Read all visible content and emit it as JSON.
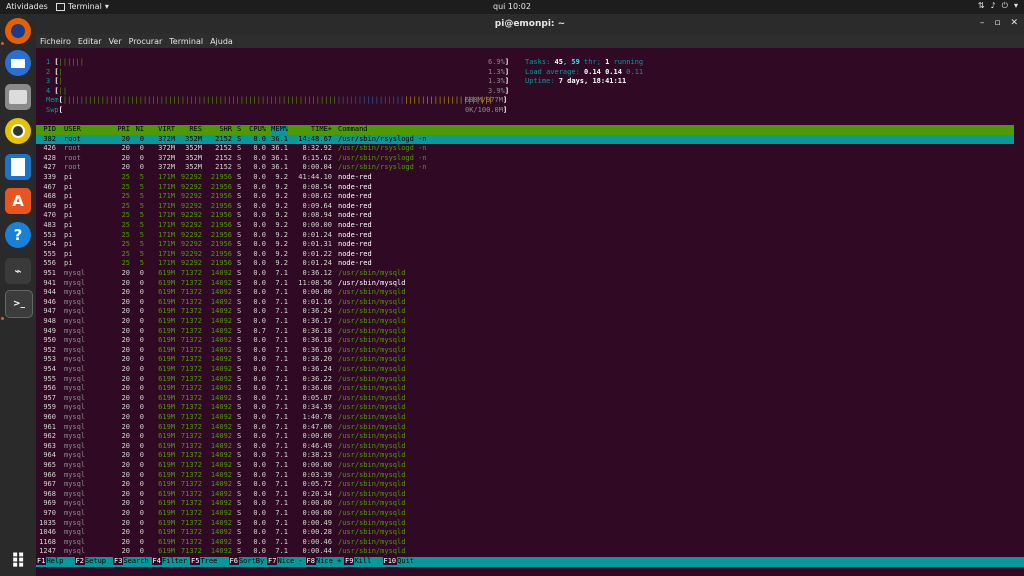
{
  "topbar": {
    "activities": "Atividades",
    "app_name": "Terminal",
    "clock": "qui 10:02"
  },
  "window": {
    "title": "pi@emonpi: ~"
  },
  "menu": [
    "Ficheiro",
    "Editar",
    "Ver",
    "Procurar",
    "Terminal",
    "Ajuda"
  ],
  "meters": {
    "cpus": [
      {
        "label": "1",
        "bars": "||||||",
        "percent": "6.9%"
      },
      {
        "label": "2",
        "bars": "|",
        "percent": "1.3%"
      },
      {
        "label": "3",
        "bars": "|",
        "percent": "1.3%"
      },
      {
        "label": "4",
        "bars": "||",
        "percent": "3.9%"
      }
    ],
    "mem": {
      "label": "Mem",
      "value": "688M/977M"
    },
    "swp": {
      "label": "Swp",
      "value": "0K/100.0M"
    },
    "tasks": {
      "label": "Tasks:",
      "count": "45",
      "threads": "59",
      "thr_label": "thr;",
      "running": "1",
      "running_label": "running"
    },
    "load": {
      "label": "Load average:",
      "v1": "0.14",
      "v2": "0.14",
      "v3": "0.11"
    },
    "uptime": {
      "label": "Uptime:",
      "value": "7 days, 18:41:11"
    }
  },
  "columns": [
    "PID",
    "USER",
    "PRI",
    "NI",
    "VIRT",
    "RES",
    "SHR",
    "S",
    "CPU%",
    "MEM%",
    "TIME+",
    "Command"
  ],
  "processes": [
    {
      "pid": "382",
      "user": "root",
      "pri": "20",
      "ni": "0",
      "virt": "372M",
      "res": "352M",
      "shr": "2152",
      "s": "S",
      "cpu": "0.0",
      "mem": "36.1",
      "time": "14:48.67",
      "cmd": "/usr/sbin/rsyslogd -n"
    },
    {
      "pid": "426",
      "user": "root",
      "pri": "20",
      "ni": "0",
      "virt": "372M",
      "res": "352M",
      "shr": "2152",
      "s": "S",
      "cpu": "0.0",
      "mem": "36.1",
      "time": "8:32.92",
      "cmd": "/usr/sbin/rsyslogd -n"
    },
    {
      "pid": "428",
      "user": "root",
      "pri": "20",
      "ni": "0",
      "virt": "372M",
      "res": "352M",
      "shr": "2152",
      "s": "S",
      "cpu": "0.0",
      "mem": "36.1",
      "time": "6:15.62",
      "cmd": "/usr/sbin/rsyslogd -n"
    },
    {
      "pid": "427",
      "user": "root",
      "pri": "20",
      "ni": "0",
      "virt": "372M",
      "res": "352M",
      "shr": "2152",
      "s": "S",
      "cpu": "0.0",
      "mem": "36.1",
      "time": "0:00.04",
      "cmd": "/usr/sbin/rsyslogd -n"
    },
    {
      "pid": "339",
      "user": "pi",
      "pri": "25",
      "ni": "5",
      "virt": "171M",
      "res": "92292",
      "shr": "21956",
      "s": "S",
      "cpu": "0.0",
      "mem": "9.2",
      "time": "41:44.10",
      "cmd": "node-red"
    },
    {
      "pid": "467",
      "user": "pi",
      "pri": "25",
      "ni": "5",
      "virt": "171M",
      "res": "92292",
      "shr": "21956",
      "s": "S",
      "cpu": "0.0",
      "mem": "9.2",
      "time": "0:08.54",
      "cmd": "node-red"
    },
    {
      "pid": "468",
      "user": "pi",
      "pri": "25",
      "ni": "5",
      "virt": "171M",
      "res": "92292",
      "shr": "21956",
      "s": "S",
      "cpu": "0.0",
      "mem": "9.2",
      "time": "0:08.62",
      "cmd": "node-red"
    },
    {
      "pid": "469",
      "user": "pi",
      "pri": "25",
      "ni": "5",
      "virt": "171M",
      "res": "92292",
      "shr": "21956",
      "s": "S",
      "cpu": "0.0",
      "mem": "9.2",
      "time": "0:09.64",
      "cmd": "node-red"
    },
    {
      "pid": "470",
      "user": "pi",
      "pri": "25",
      "ni": "5",
      "virt": "171M",
      "res": "92292",
      "shr": "21956",
      "s": "S",
      "cpu": "0.0",
      "mem": "9.2",
      "time": "0:08.94",
      "cmd": "node-red"
    },
    {
      "pid": "483",
      "user": "pi",
      "pri": "25",
      "ni": "5",
      "virt": "171M",
      "res": "92292",
      "shr": "21956",
      "s": "S",
      "cpu": "0.0",
      "mem": "9.2",
      "time": "0:00.00",
      "cmd": "node-red"
    },
    {
      "pid": "553",
      "user": "pi",
      "pri": "25",
      "ni": "5",
      "virt": "171M",
      "res": "92292",
      "shr": "21956",
      "s": "S",
      "cpu": "0.0",
      "mem": "9.2",
      "time": "0:01.24",
      "cmd": "node-red"
    },
    {
      "pid": "554",
      "user": "pi",
      "pri": "25",
      "ni": "5",
      "virt": "171M",
      "res": "92292",
      "shr": "21956",
      "s": "S",
      "cpu": "0.0",
      "mem": "9.2",
      "time": "0:01.31",
      "cmd": "node-red"
    },
    {
      "pid": "555",
      "user": "pi",
      "pri": "25",
      "ni": "5",
      "virt": "171M",
      "res": "92292",
      "shr": "21956",
      "s": "S",
      "cpu": "0.0",
      "mem": "9.2",
      "time": "0:01.22",
      "cmd": "node-red"
    },
    {
      "pid": "556",
      "user": "pi",
      "pri": "25",
      "ni": "5",
      "virt": "171M",
      "res": "92292",
      "shr": "21956",
      "s": "S",
      "cpu": "0.0",
      "mem": "9.2",
      "time": "0:01.24",
      "cmd": "node-red"
    },
    {
      "pid": "951",
      "user": "mysql",
      "pri": "20",
      "ni": "0",
      "virt": "619M",
      "res": "71372",
      "shr": "14092",
      "s": "S",
      "cpu": "0.0",
      "mem": "7.1",
      "time": "0:36.12",
      "cmd": "/usr/sbin/mysqld"
    },
    {
      "pid": "941",
      "user": "mysql",
      "pri": "20",
      "ni": "0",
      "virt": "619M",
      "res": "71372",
      "shr": "14092",
      "s": "S",
      "cpu": "0.0",
      "mem": "7.1",
      "time": "11:08.56",
      "cmd": "/usr/sbin/mysqld",
      "main": true
    },
    {
      "pid": "944",
      "user": "mysql",
      "pri": "20",
      "ni": "0",
      "virt": "619M",
      "res": "71372",
      "shr": "14092",
      "s": "S",
      "cpu": "0.0",
      "mem": "7.1",
      "time": "0:00.00",
      "cmd": "/usr/sbin/mysqld"
    },
    {
      "pid": "946",
      "user": "mysql",
      "pri": "20",
      "ni": "0",
      "virt": "619M",
      "res": "71372",
      "shr": "14092",
      "s": "S",
      "cpu": "0.0",
      "mem": "7.1",
      "time": "0:01.16",
      "cmd": "/usr/sbin/mysqld"
    },
    {
      "pid": "947",
      "user": "mysql",
      "pri": "20",
      "ni": "0",
      "virt": "619M",
      "res": "71372",
      "shr": "14092",
      "s": "S",
      "cpu": "0.0",
      "mem": "7.1",
      "time": "0:36.24",
      "cmd": "/usr/sbin/mysqld"
    },
    {
      "pid": "948",
      "user": "mysql",
      "pri": "20",
      "ni": "0",
      "virt": "619M",
      "res": "71372",
      "shr": "14092",
      "s": "S",
      "cpu": "0.0",
      "mem": "7.1",
      "time": "0:36.17",
      "cmd": "/usr/sbin/mysqld"
    },
    {
      "pid": "949",
      "user": "mysql",
      "pri": "20",
      "ni": "0",
      "virt": "619M",
      "res": "71372",
      "shr": "14092",
      "s": "S",
      "cpu": "0.7",
      "mem": "7.1",
      "time": "0:36.18",
      "cmd": "/usr/sbin/mysqld"
    },
    {
      "pid": "950",
      "user": "mysql",
      "pri": "20",
      "ni": "0",
      "virt": "619M",
      "res": "71372",
      "shr": "14092",
      "s": "S",
      "cpu": "0.0",
      "mem": "7.1",
      "time": "0:36.18",
      "cmd": "/usr/sbin/mysqld"
    },
    {
      "pid": "952",
      "user": "mysql",
      "pri": "20",
      "ni": "0",
      "virt": "619M",
      "res": "71372",
      "shr": "14092",
      "s": "S",
      "cpu": "0.0",
      "mem": "7.1",
      "time": "0:36.10",
      "cmd": "/usr/sbin/mysqld"
    },
    {
      "pid": "953",
      "user": "mysql",
      "pri": "20",
      "ni": "0",
      "virt": "619M",
      "res": "71372",
      "shr": "14092",
      "s": "S",
      "cpu": "0.0",
      "mem": "7.1",
      "time": "0:36.20",
      "cmd": "/usr/sbin/mysqld"
    },
    {
      "pid": "954",
      "user": "mysql",
      "pri": "20",
      "ni": "0",
      "virt": "619M",
      "res": "71372",
      "shr": "14092",
      "s": "S",
      "cpu": "0.0",
      "mem": "7.1",
      "time": "0:36.24",
      "cmd": "/usr/sbin/mysqld"
    },
    {
      "pid": "955",
      "user": "mysql",
      "pri": "20",
      "ni": "0",
      "virt": "619M",
      "res": "71372",
      "shr": "14092",
      "s": "S",
      "cpu": "0.0",
      "mem": "7.1",
      "time": "0:36.22",
      "cmd": "/usr/sbin/mysqld"
    },
    {
      "pid": "956",
      "user": "mysql",
      "pri": "20",
      "ni": "0",
      "virt": "619M",
      "res": "71372",
      "shr": "14092",
      "s": "S",
      "cpu": "0.0",
      "mem": "7.1",
      "time": "0:36.08",
      "cmd": "/usr/sbin/mysqld"
    },
    {
      "pid": "957",
      "user": "mysql",
      "pri": "20",
      "ni": "0",
      "virt": "619M",
      "res": "71372",
      "shr": "14092",
      "s": "S",
      "cpu": "0.0",
      "mem": "7.1",
      "time": "0:05.87",
      "cmd": "/usr/sbin/mysqld"
    },
    {
      "pid": "959",
      "user": "mysql",
      "pri": "20",
      "ni": "0",
      "virt": "619M",
      "res": "71372",
      "shr": "14092",
      "s": "S",
      "cpu": "0.0",
      "mem": "7.1",
      "time": "0:34.39",
      "cmd": "/usr/sbin/mysqld"
    },
    {
      "pid": "960",
      "user": "mysql",
      "pri": "20",
      "ni": "0",
      "virt": "619M",
      "res": "71372",
      "shr": "14092",
      "s": "S",
      "cpu": "0.0",
      "mem": "7.1",
      "time": "1:40.78",
      "cmd": "/usr/sbin/mysqld"
    },
    {
      "pid": "961",
      "user": "mysql",
      "pri": "20",
      "ni": "0",
      "virt": "619M",
      "res": "71372",
      "shr": "14092",
      "s": "S",
      "cpu": "0.0",
      "mem": "7.1",
      "time": "0:47.00",
      "cmd": "/usr/sbin/mysqld"
    },
    {
      "pid": "962",
      "user": "mysql",
      "pri": "20",
      "ni": "0",
      "virt": "619M",
      "res": "71372",
      "shr": "14092",
      "s": "S",
      "cpu": "0.0",
      "mem": "7.1",
      "time": "0:00.00",
      "cmd": "/usr/sbin/mysqld"
    },
    {
      "pid": "963",
      "user": "mysql",
      "pri": "20",
      "ni": "0",
      "virt": "619M",
      "res": "71372",
      "shr": "14092",
      "s": "S",
      "cpu": "0.0",
      "mem": "7.1",
      "time": "0:46.49",
      "cmd": "/usr/sbin/mysqld"
    },
    {
      "pid": "964",
      "user": "mysql",
      "pri": "20",
      "ni": "0",
      "virt": "619M",
      "res": "71372",
      "shr": "14092",
      "s": "S",
      "cpu": "0.0",
      "mem": "7.1",
      "time": "0:38.23",
      "cmd": "/usr/sbin/mysqld"
    },
    {
      "pid": "965",
      "user": "mysql",
      "pri": "20",
      "ni": "0",
      "virt": "619M",
      "res": "71372",
      "shr": "14092",
      "s": "S",
      "cpu": "0.0",
      "mem": "7.1",
      "time": "0:00.00",
      "cmd": "/usr/sbin/mysqld"
    },
    {
      "pid": "966",
      "user": "mysql",
      "pri": "20",
      "ni": "0",
      "virt": "619M",
      "res": "71372",
      "shr": "14092",
      "s": "S",
      "cpu": "0.0",
      "mem": "7.1",
      "time": "0:03.39",
      "cmd": "/usr/sbin/mysqld"
    },
    {
      "pid": "967",
      "user": "mysql",
      "pri": "20",
      "ni": "0",
      "virt": "619M",
      "res": "71372",
      "shr": "14092",
      "s": "S",
      "cpu": "0.0",
      "mem": "7.1",
      "time": "0:05.72",
      "cmd": "/usr/sbin/mysqld"
    },
    {
      "pid": "968",
      "user": "mysql",
      "pri": "20",
      "ni": "0",
      "virt": "619M",
      "res": "71372",
      "shr": "14092",
      "s": "S",
      "cpu": "0.0",
      "mem": "7.1",
      "time": "0:20.34",
      "cmd": "/usr/sbin/mysqld"
    },
    {
      "pid": "969",
      "user": "mysql",
      "pri": "20",
      "ni": "0",
      "virt": "619M",
      "res": "71372",
      "shr": "14092",
      "s": "S",
      "cpu": "0.0",
      "mem": "7.1",
      "time": "0:00.00",
      "cmd": "/usr/sbin/mysqld"
    },
    {
      "pid": "970",
      "user": "mysql",
      "pri": "20",
      "ni": "0",
      "virt": "619M",
      "res": "71372",
      "shr": "14092",
      "s": "S",
      "cpu": "0.0",
      "mem": "7.1",
      "time": "0:00.00",
      "cmd": "/usr/sbin/mysqld"
    },
    {
      "pid": "1035",
      "user": "mysql",
      "pri": "20",
      "ni": "0",
      "virt": "619M",
      "res": "71372",
      "shr": "14092",
      "s": "S",
      "cpu": "0.0",
      "mem": "7.1",
      "time": "0:00.49",
      "cmd": "/usr/sbin/mysqld"
    },
    {
      "pid": "1046",
      "user": "mysql",
      "pri": "20",
      "ni": "0",
      "virt": "619M",
      "res": "71372",
      "shr": "14092",
      "s": "S",
      "cpu": "0.0",
      "mem": "7.1",
      "time": "0:00.28",
      "cmd": "/usr/sbin/mysqld"
    },
    {
      "pid": "1168",
      "user": "mysql",
      "pri": "20",
      "ni": "0",
      "virt": "619M",
      "res": "71372",
      "shr": "14092",
      "s": "S",
      "cpu": "0.0",
      "mem": "7.1",
      "time": "0:00.46",
      "cmd": "/usr/sbin/mysqld"
    },
    {
      "pid": "1247",
      "user": "mysql",
      "pri": "20",
      "ni": "0",
      "virt": "619M",
      "res": "71372",
      "shr": "14092",
      "s": "S",
      "cpu": "0.0",
      "mem": "7.1",
      "time": "0:00.44",
      "cmd": "/usr/sbin/mysqld"
    }
  ],
  "function_keys": [
    {
      "key": "F1",
      "label": "Help"
    },
    {
      "key": "F2",
      "label": "Setup"
    },
    {
      "key": "F3",
      "label": "Search"
    },
    {
      "key": "F4",
      "label": "Filter"
    },
    {
      "key": "F5",
      "label": "Tree"
    },
    {
      "key": "F6",
      "label": "SortBy"
    },
    {
      "key": "F7",
      "label": "Nice -"
    },
    {
      "key": "F8",
      "label": "Nice +"
    },
    {
      "key": "F9",
      "label": "Kill"
    },
    {
      "key": "F10",
      "label": "Quit"
    }
  ],
  "colors": {
    "header_bg": "#4e9a06",
    "selected_bg": "#06989a",
    "terminal_bg": "#300a24",
    "dock_accent": "#e95420"
  },
  "dock": [
    {
      "name": "firefox-icon",
      "glyph": "",
      "bg": "#e66000"
    },
    {
      "name": "thunderbird-icon",
      "glyph": "",
      "bg": "#2a6fd6"
    },
    {
      "name": "files-icon",
      "glyph": "",
      "bg": "#8a8a8a"
    },
    {
      "name": "rhythmbox-icon",
      "glyph": "",
      "bg": "#e6c200"
    },
    {
      "name": "writer-icon",
      "glyph": "",
      "bg": "#1e73c8"
    },
    {
      "name": "software-icon",
      "glyph": "A",
      "bg": "#e95420"
    },
    {
      "name": "help-icon",
      "glyph": "?",
      "bg": "#1a7fd6"
    },
    {
      "name": "system-monitor-icon",
      "glyph": "",
      "bg": "#3a3a3a"
    },
    {
      "name": "terminal-icon",
      "glyph": ">_",
      "bg": "#3c3c3c"
    },
    {
      "name": "apps-grid-icon",
      "glyph": "⠿",
      "bg": "transparent"
    }
  ]
}
